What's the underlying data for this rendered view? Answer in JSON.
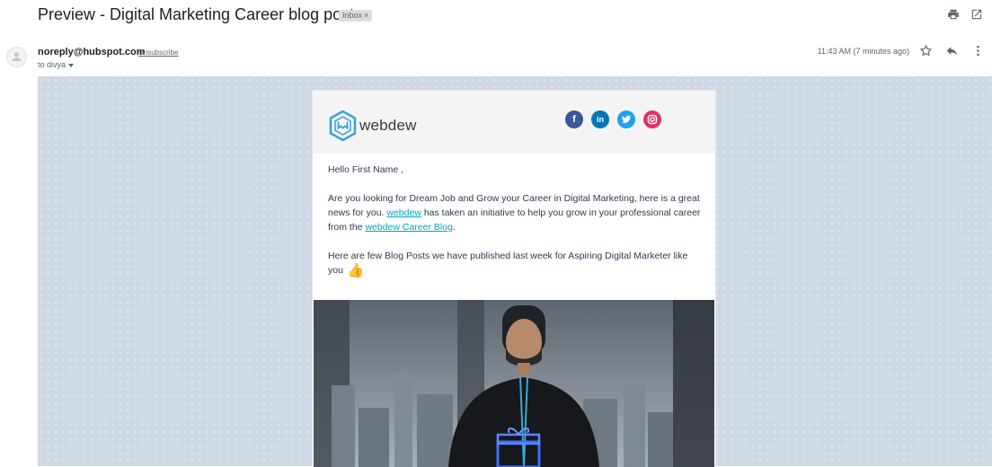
{
  "subject": {
    "title": "Preview - Digital Marketing Career blog post",
    "label": "Inbox",
    "label_close": "×"
  },
  "toolbar": {
    "print_icon": "print-icon",
    "open_new_window_icon": "open-in-new-icon"
  },
  "message": {
    "sender_email": "noreply@hubspot.com",
    "unsubscribe": "Unsubscribe",
    "to_line": "to divya",
    "time": "11:43 AM (7 minutes ago)",
    "icons": [
      "star-icon",
      "reply-icon",
      "more-vert-icon"
    ]
  },
  "email": {
    "logo_text": "webdew",
    "socials": [
      {
        "name": "facebook-icon",
        "glyph": "f"
      },
      {
        "name": "linkedin-icon",
        "glyph": "in"
      },
      {
        "name": "twitter-icon",
        "glyph": "t"
      },
      {
        "name": "instagram-icon",
        "glyph": "◎"
      }
    ],
    "greeting": "Hello First Name ,",
    "para1_a": "Are you looking for Dream Job and Grow your Career in Digital Marketing, here is a great news for you. ",
    "para1_link1": "webdew",
    "para1_b": " has taken an initiative to help you grow in your professional career from the ",
    "para1_link2": "webdew Career Blog",
    "para1_c": ".",
    "para2": "Here are few Blog Posts we have published last week for Aspiring Digital Marketer like you",
    "thumb": "👍",
    "brand_colors": {
      "accent": "#00a4bd",
      "logo": "#3aa0d8"
    }
  }
}
